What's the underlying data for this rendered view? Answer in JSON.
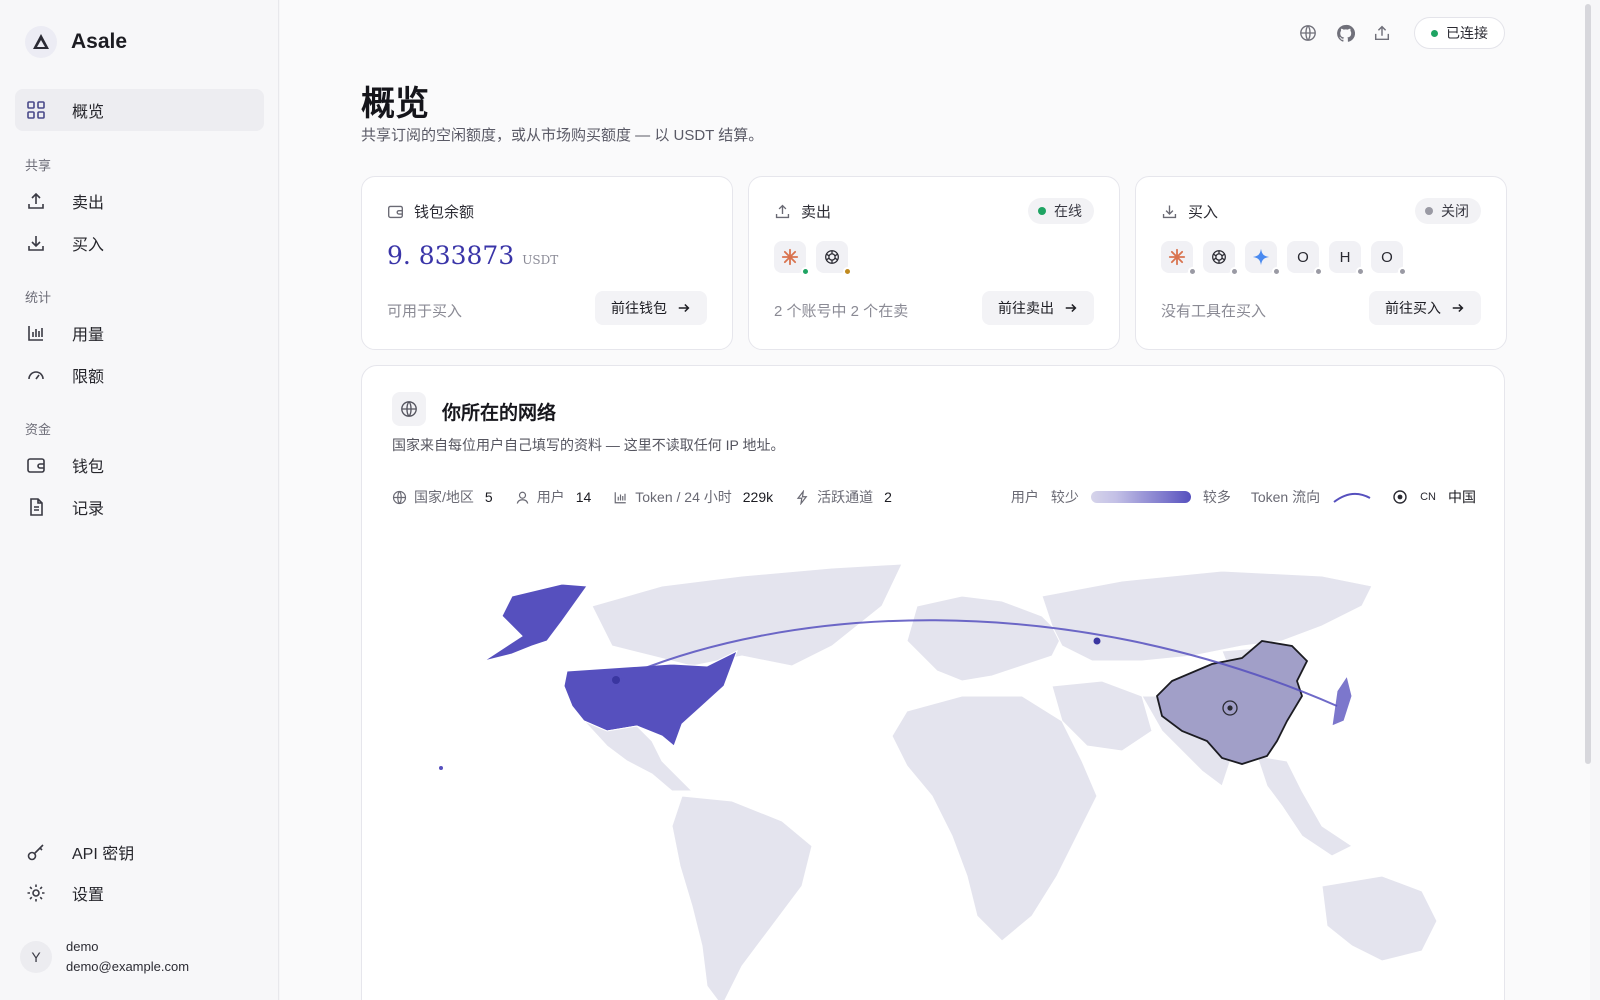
{
  "brand": {
    "name": "Asale"
  },
  "sidebar": {
    "overview": "概览",
    "section_share": "共享",
    "sell": "卖出",
    "buy": "买入",
    "section_stats": "统计",
    "usage": "用量",
    "limits": "限额",
    "section_funds": "资金",
    "wallet": "钱包",
    "records": "记录",
    "api_keys": "API 密钥",
    "settings": "设置"
  },
  "user": {
    "avatar_letter": "Y",
    "name": "demo",
    "email": "demo@example.com"
  },
  "topbar": {
    "status": "已连接",
    "status_color": "#1fa463"
  },
  "page": {
    "title": "概览",
    "subtitle": "共享订阅的空闲额度，或从市场购买额度 — 以 USDT 结算。"
  },
  "cards": {
    "wallet": {
      "label": "钱包余额",
      "balance": "9. 833873",
      "unit": "USDT",
      "note": "可用于买入",
      "button": "前往钱包"
    },
    "sell": {
      "label": "卖出",
      "status": "在线",
      "status_color": "#1fa463",
      "note": "2 个账号中 2 个在卖",
      "button": "前往卖出",
      "tools": [
        {
          "icon": "claude-icon",
          "status_color": "#1fa463"
        },
        {
          "icon": "openai-icon",
          "status_color": "#c08a1f"
        }
      ]
    },
    "buy": {
      "label": "买入",
      "status": "关闭",
      "status_color": "#9a9aa4",
      "note": "没有工具在买入",
      "button": "前往买入",
      "tools": [
        {
          "icon": "claude-icon",
          "letter": ""
        },
        {
          "icon": "openai-icon",
          "letter": ""
        },
        {
          "icon": "gemini-icon",
          "letter": ""
        },
        {
          "icon": "o-icon",
          "letter": "O"
        },
        {
          "icon": "h-icon",
          "letter": "H"
        },
        {
          "icon": "o-icon",
          "letter": "O"
        }
      ]
    }
  },
  "network": {
    "title": "你所在的网络",
    "subtitle": "国家来自每位用户自己填写的资料 — 这里不读取任何 IP 地址。",
    "stats": {
      "countries_label": "国家/地区",
      "countries_value": "5",
      "users_label": "用户",
      "users_value": "14",
      "tokens_label": "Token / 24 小时",
      "tokens_value": "229k",
      "channels_label": "活跃通道",
      "channels_value": "2"
    },
    "legend": {
      "users": "用户",
      "less": "较少",
      "more": "较多",
      "flow": "Token 流向",
      "code": "CN",
      "country": "中国"
    }
  },
  "colors": {
    "accent": "#5650be",
    "map_land": "#e4e4ee",
    "map_china": "#a19fc8"
  }
}
